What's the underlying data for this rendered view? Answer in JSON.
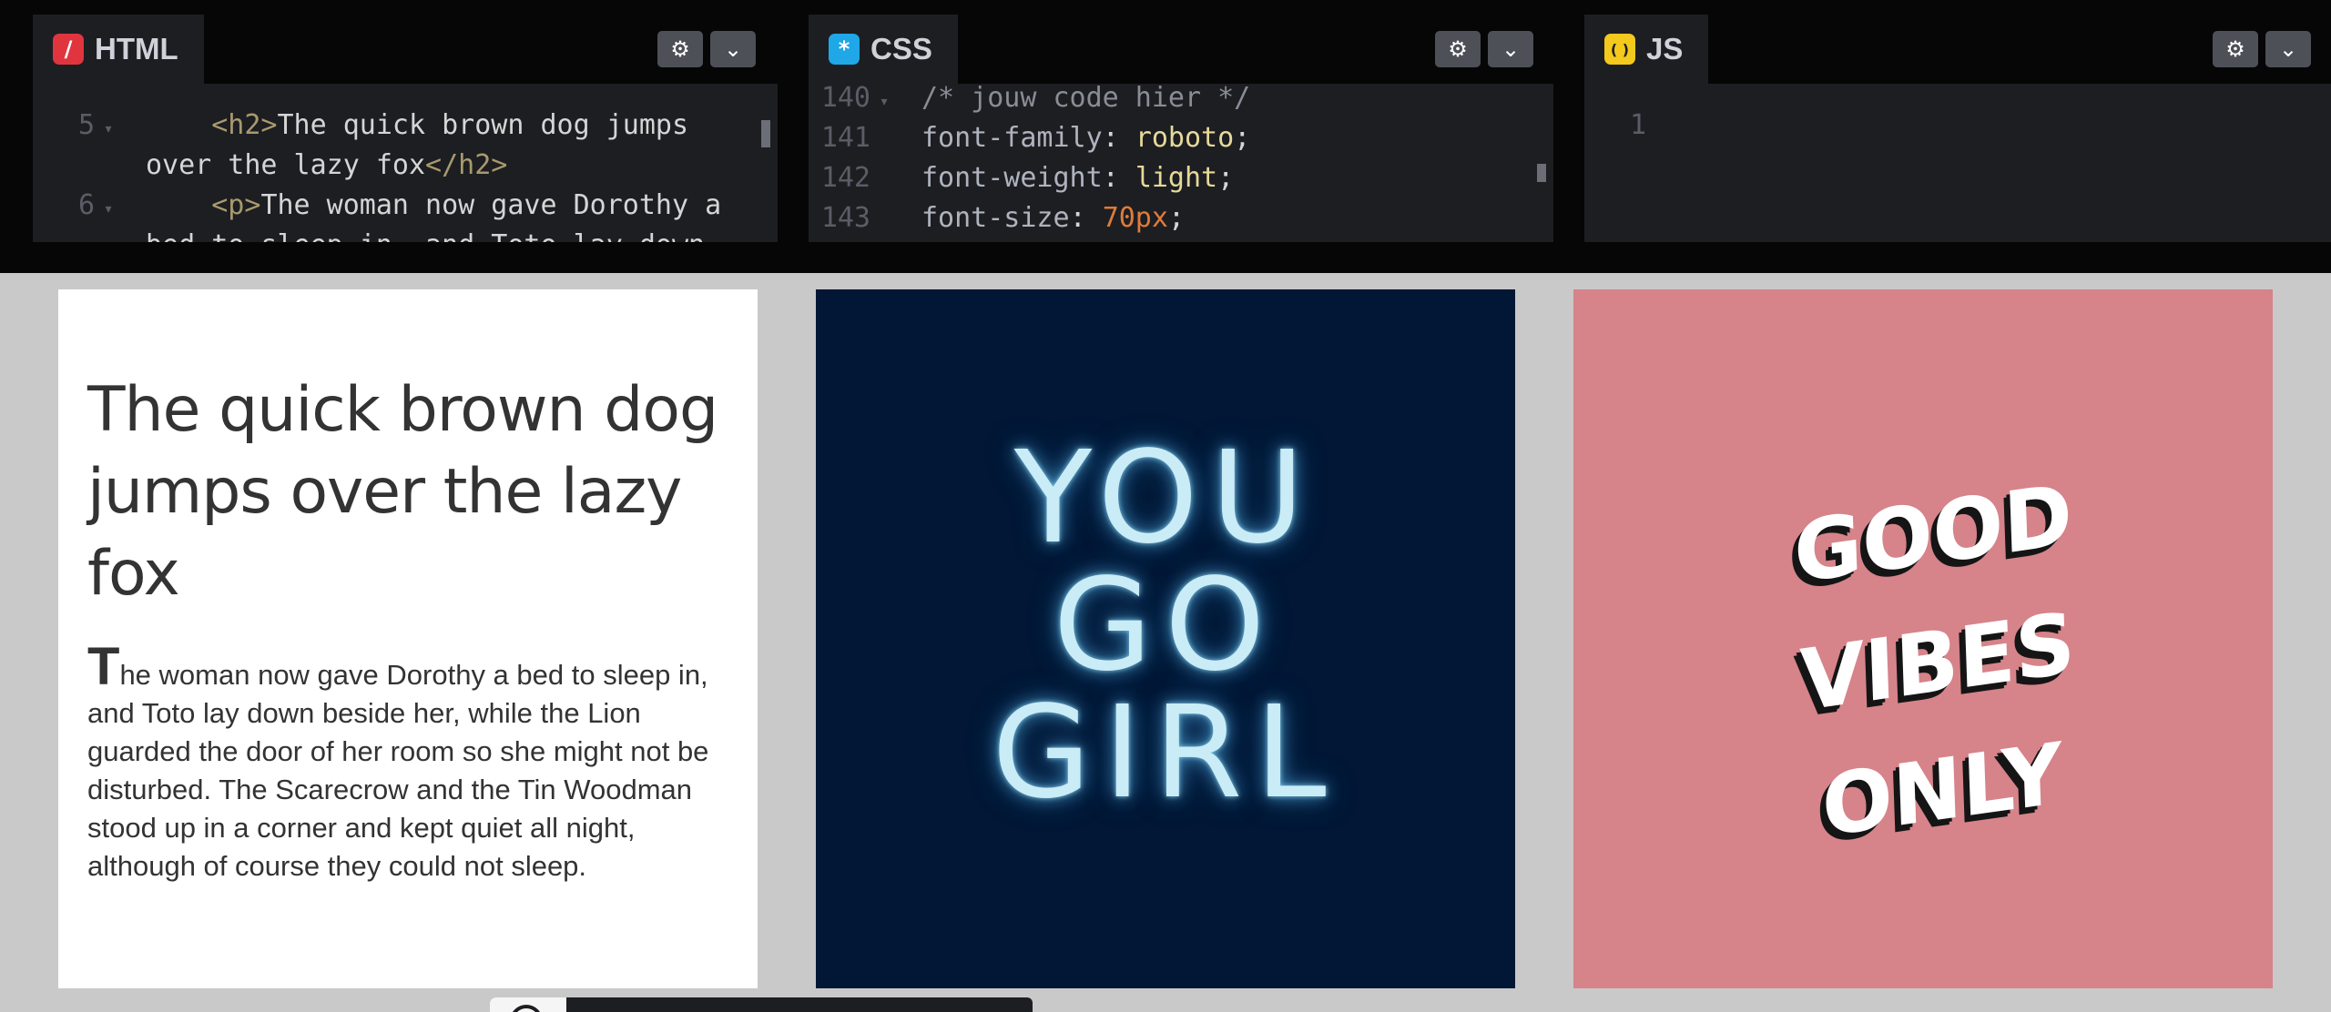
{
  "editors": {
    "html": {
      "tab_label": "HTML",
      "badge_glyph": "/",
      "badge_color": "#e0353f",
      "lines": [
        {
          "num": "5",
          "fold": "▾",
          "parts": [
            {
              "t": "    ",
              "c": ""
            },
            {
              "t": "<h2>",
              "c": "tag"
            },
            {
              "t": "The quick brown dog jumps",
              "c": ""
            }
          ]
        },
        {
          "num": "",
          "fold": "",
          "parts": [
            {
              "t": "over the lazy fox",
              "c": ""
            },
            {
              "t": "</h2>",
              "c": "tag"
            }
          ]
        },
        {
          "num": "6",
          "fold": "▾",
          "parts": [
            {
              "t": "    ",
              "c": ""
            },
            {
              "t": "<p>",
              "c": "tag"
            },
            {
              "t": "The woman now gave Dorothy a",
              "c": ""
            }
          ]
        },
        {
          "num": "",
          "fold": "",
          "parts": [
            {
              "t": "bed to sleep in, and Toto lay down",
              "c": ""
            }
          ]
        }
      ]
    },
    "css": {
      "tab_label": "CSS",
      "badge_glyph": "*",
      "badge_color": "#1fa7e8",
      "lines": [
        {
          "num": "140",
          "fold": "▾",
          "parts": [
            {
              "t": "/* jouw code hier */",
              "c": "cmt"
            }
          ]
        },
        {
          "num": "141",
          "fold": "",
          "parts": [
            {
              "t": "font-family",
              "c": "prop"
            },
            {
              "t": ": ",
              "c": ""
            },
            {
              "t": "roboto",
              "c": "val-y"
            },
            {
              "t": ";",
              "c": ""
            }
          ]
        },
        {
          "num": "142",
          "fold": "",
          "parts": [
            {
              "t": "font-weight",
              "c": "prop"
            },
            {
              "t": ": ",
              "c": ""
            },
            {
              "t": "light",
              "c": "val-y"
            },
            {
              "t": ";",
              "c": ""
            }
          ]
        },
        {
          "num": "143",
          "fold": "",
          "parts": [
            {
              "t": "font-size",
              "c": "prop"
            },
            {
              "t": ": ",
              "c": ""
            },
            {
              "t": "70px",
              "c": "val-o"
            },
            {
              "t": ";",
              "c": ""
            }
          ]
        }
      ]
    },
    "js": {
      "tab_label": "JS",
      "badge_glyph": "( )",
      "badge_color": "#f2c91c",
      "lines": [
        {
          "num": "1",
          "fold": "",
          "parts": []
        }
      ]
    },
    "settings_icon": "gear-icon",
    "collapse_icon": "chevron-down-icon"
  },
  "preview": {
    "card1": {
      "heading": "The quick brown dog jumps over the lazy fox",
      "dropcap": "T",
      "paragraph_rest": "he woman now gave Dorothy a bed to sleep in, and Toto lay down beside her, while the Lion guarded the door of her room so she might not be disturbed. The Scarecrow and the Tin Woodman stood up in a corner and kept quiet all night, although of course they could not sleep."
    },
    "card2": {
      "lines": [
        "YOU",
        "GO",
        "GIRL"
      ],
      "background": "#011735",
      "glow_color": "#c9ecf7"
    },
    "card3": {
      "lines": [
        "GOOD",
        "VIBES",
        "ONLY"
      ],
      "background": "#d6838a"
    }
  }
}
